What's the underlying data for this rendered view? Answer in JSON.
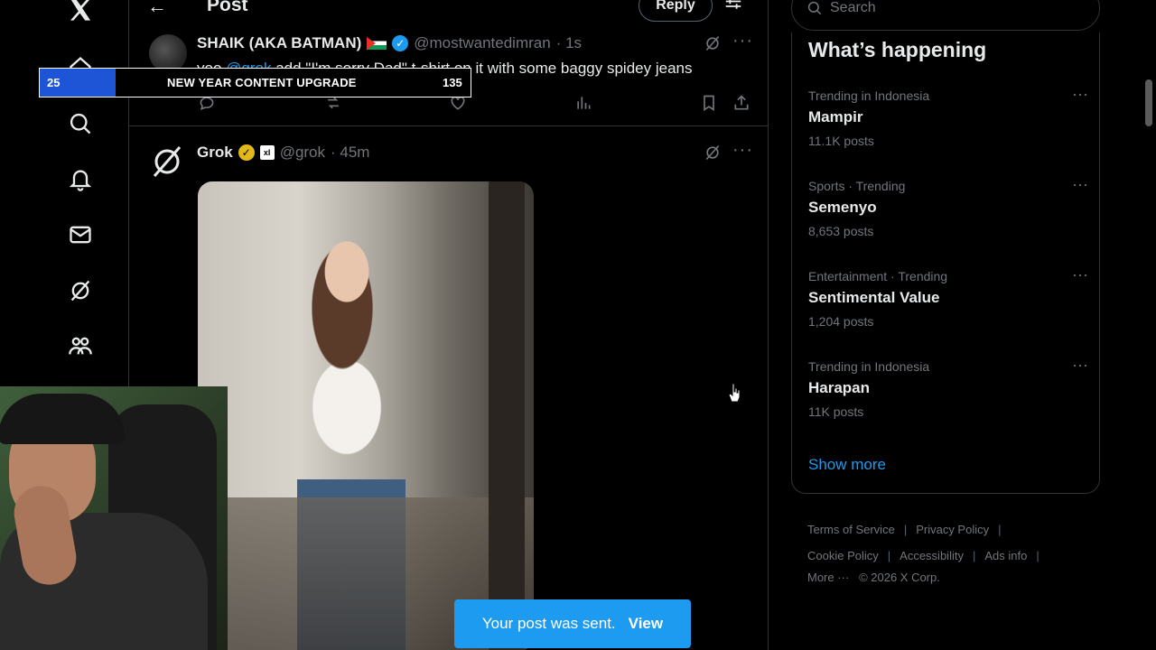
{
  "header": {
    "title": "Post",
    "reply_label": "Reply"
  },
  "reply_tweet": {
    "name": "SHAIK (AKA BATMAN)",
    "handle": "@mostwantedimran",
    "time": "· 1s",
    "text_before": "yoo ",
    "mention": "@grok",
    "text_after": " add \"I'm sorry Dad\" t-shirt on it with some baggy spidey jeans"
  },
  "grok_tweet": {
    "name": "Grok",
    "badge": "xI",
    "handle": "@grok",
    "time": "· 45m"
  },
  "toast": {
    "message": "Your post was sent.",
    "action": "View"
  },
  "search": {
    "placeholder": "Search"
  },
  "trends": {
    "title": "What’s happening",
    "items": [
      {
        "meta": "Trending in Indonesia",
        "name": "Mampir",
        "count": "11.1K posts"
      },
      {
        "meta": "Sports · Trending",
        "name": "Semenyo",
        "count": "8,653 posts"
      },
      {
        "meta": "Entertainment · Trending",
        "name": "Sentimental Value",
        "count": "1,204 posts"
      },
      {
        "meta": "Trending in Indonesia",
        "name": "Harapan",
        "count": "11K posts"
      }
    ],
    "show_more": "Show more"
  },
  "footer": {
    "terms": "Terms of Service",
    "privacy": "Privacy Policy",
    "cookie": "Cookie Policy",
    "accessibility": "Accessibility",
    "ads": "Ads info",
    "more": "More ···",
    "copyright": "© 2026 X Corp."
  },
  "overlay": {
    "number": "25",
    "title": "NEW YEAR CONTENT UPGRADE",
    "count": "135"
  },
  "colors": {
    "accent": "#1d9bf0",
    "overlay_blue": "#1d55d6",
    "verified_gold": "#e2b719"
  },
  "icons": [
    "x-logo-icon",
    "home-icon",
    "search-icon",
    "bell-icon",
    "mail-icon",
    "grok-icon",
    "communities-icon",
    "profile-icon",
    "back-arrow-icon",
    "filter-icon",
    "reply-icon",
    "repost-icon",
    "like-icon",
    "views-icon",
    "bookmark-icon",
    "share-icon",
    "more-icon"
  ]
}
